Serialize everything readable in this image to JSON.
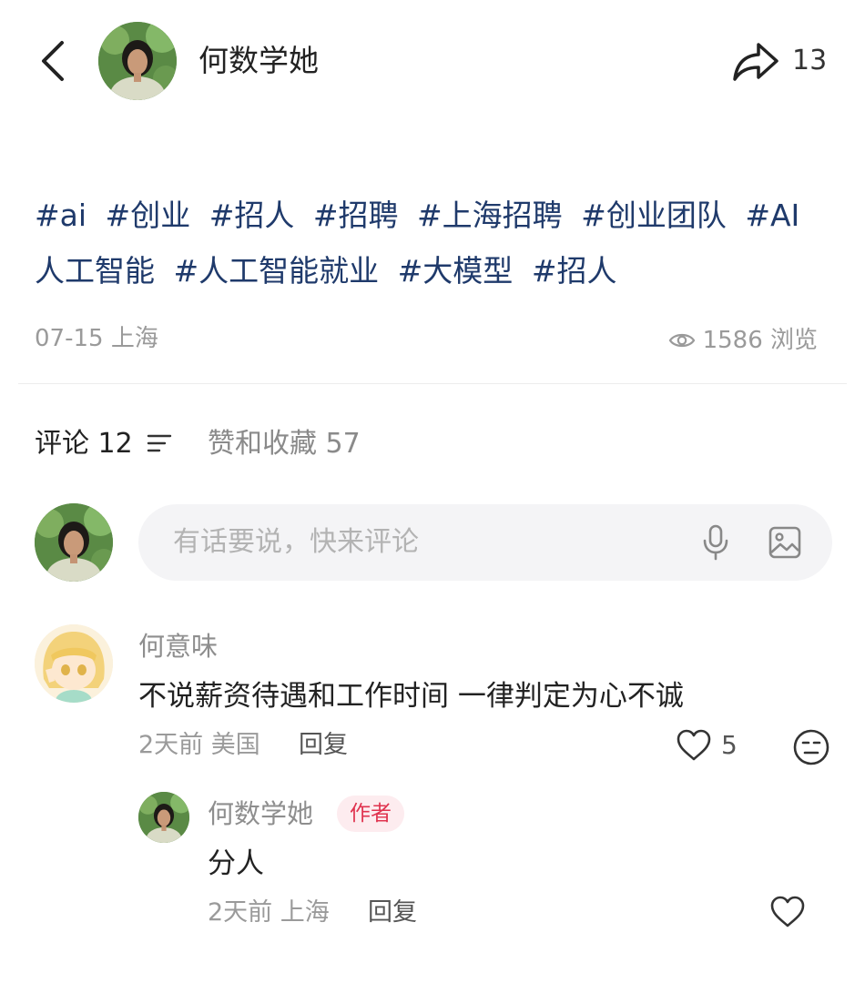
{
  "header": {
    "author_name": "何数学她",
    "share_count": "13",
    "icons": {
      "back": "back-chevron-icon",
      "share": "share-arrow-icon"
    }
  },
  "post": {
    "tags": [
      "#ai",
      "#创业",
      "#招人",
      "#招聘",
      "#上海招聘",
      "#创业团队",
      "#AI人工智能",
      "#人工智能就业",
      "#大模型",
      "#招人"
    ],
    "date_location": "07-15 上海",
    "views": "1586 浏览",
    "tag_color": "#1f3a6b"
  },
  "tabs": {
    "comments_label": "评论 12",
    "likes_label": "赞和收藏 57"
  },
  "comment_input": {
    "placeholder": "有话要说，快来评论",
    "icons": {
      "mic": "microphone-icon",
      "image": "image-icon"
    }
  },
  "comments": [
    {
      "user": "何意味",
      "text": "不说薪资待遇和工作时间 一律判定为心不诚",
      "time_location": "2天前 美国",
      "reply_label": "回复",
      "likes": "5",
      "replies": [
        {
          "user": "何数学她",
          "badge": "作者",
          "text": "分人",
          "time_location": "2天前 上海",
          "reply_label": "回复",
          "likes": ""
        }
      ]
    }
  ],
  "colors": {
    "badge_bg": "#fdecef",
    "badge_text": "#e0334f",
    "input_bg": "#f4f4f6"
  }
}
